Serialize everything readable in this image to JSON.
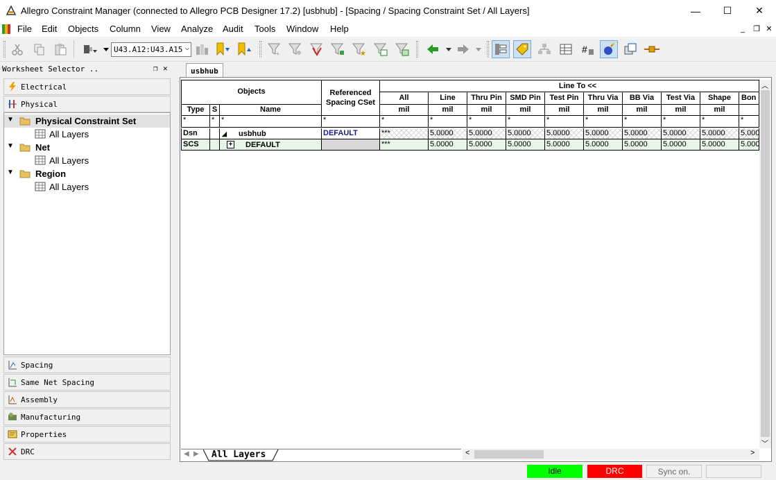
{
  "window": {
    "title": "Allegro Constraint Manager (connected to Allegro PCB Designer 17.2) [usbhub] - [Spacing / Spacing Constraint Set / All Layers]",
    "minimize": "—",
    "maximize": "☐",
    "close": "✕"
  },
  "menu": [
    "File",
    "Edit",
    "Objects",
    "Column",
    "View",
    "Analyze",
    "Audit",
    "Tools",
    "Window",
    "Help"
  ],
  "toolbar": {
    "object_combo_value": "U43.A12:U43.A15"
  },
  "worksheet_selector": {
    "title": "Worksheet Selector ..",
    "top_tabs": [
      "Electrical",
      "Physical"
    ],
    "tree": [
      {
        "label": "Physical Constraint Set",
        "bold": true,
        "selected": true
      },
      {
        "label": "All Layers",
        "bold": false
      },
      {
        "label": "Net",
        "bold": true
      },
      {
        "label": "All Layers",
        "bold": false
      },
      {
        "label": "Region",
        "bold": true
      },
      {
        "label": "All Layers",
        "bold": false
      }
    ],
    "bottom_tabs": [
      "Spacing",
      "Same Net Spacing",
      "Assembly",
      "Manufacturing",
      "Properties",
      "DRC"
    ]
  },
  "document_tab": "usbhub",
  "grid": {
    "objects_header": "Objects",
    "referenced_header": "Referenced Spacing CSet",
    "group_header": "Line To <<",
    "sub_headers": {
      "type": "Type",
      "s": "S",
      "name": "Name"
    },
    "columns": [
      "All",
      "Line",
      "Thru Pin",
      "SMD Pin",
      "Test Pin",
      "Thru Via",
      "BB Via",
      "Test Via",
      "Shape",
      "Bon"
    ],
    "unit": "mil",
    "filter": "*",
    "rows": [
      {
        "type": "Dsn",
        "s": "",
        "expander": "◢",
        "name": "usbhub",
        "cset": "DEFAULT",
        "all": "***",
        "values": [
          "5.0000",
          "5.0000",
          "5.0000",
          "5.0000",
          "5.0000",
          "5.0000",
          "5.0000",
          "5.0000",
          "5.000"
        ]
      },
      {
        "type": "SCS",
        "s": "",
        "expander": "+",
        "name": "DEFAULT",
        "cset": "",
        "all": "***",
        "values": [
          "5.0000",
          "5.0000",
          "5.0000",
          "5.0000",
          "5.0000",
          "5.0000",
          "5.0000",
          "5.0000",
          "5.000"
        ]
      }
    ]
  },
  "sheet_tab": "All Layers",
  "status": {
    "idle": "Idle",
    "drc": "DRC",
    "sync": "Sync on.",
    "colors": {
      "idle": "#00ff00",
      "drc": "#ff0000"
    }
  }
}
